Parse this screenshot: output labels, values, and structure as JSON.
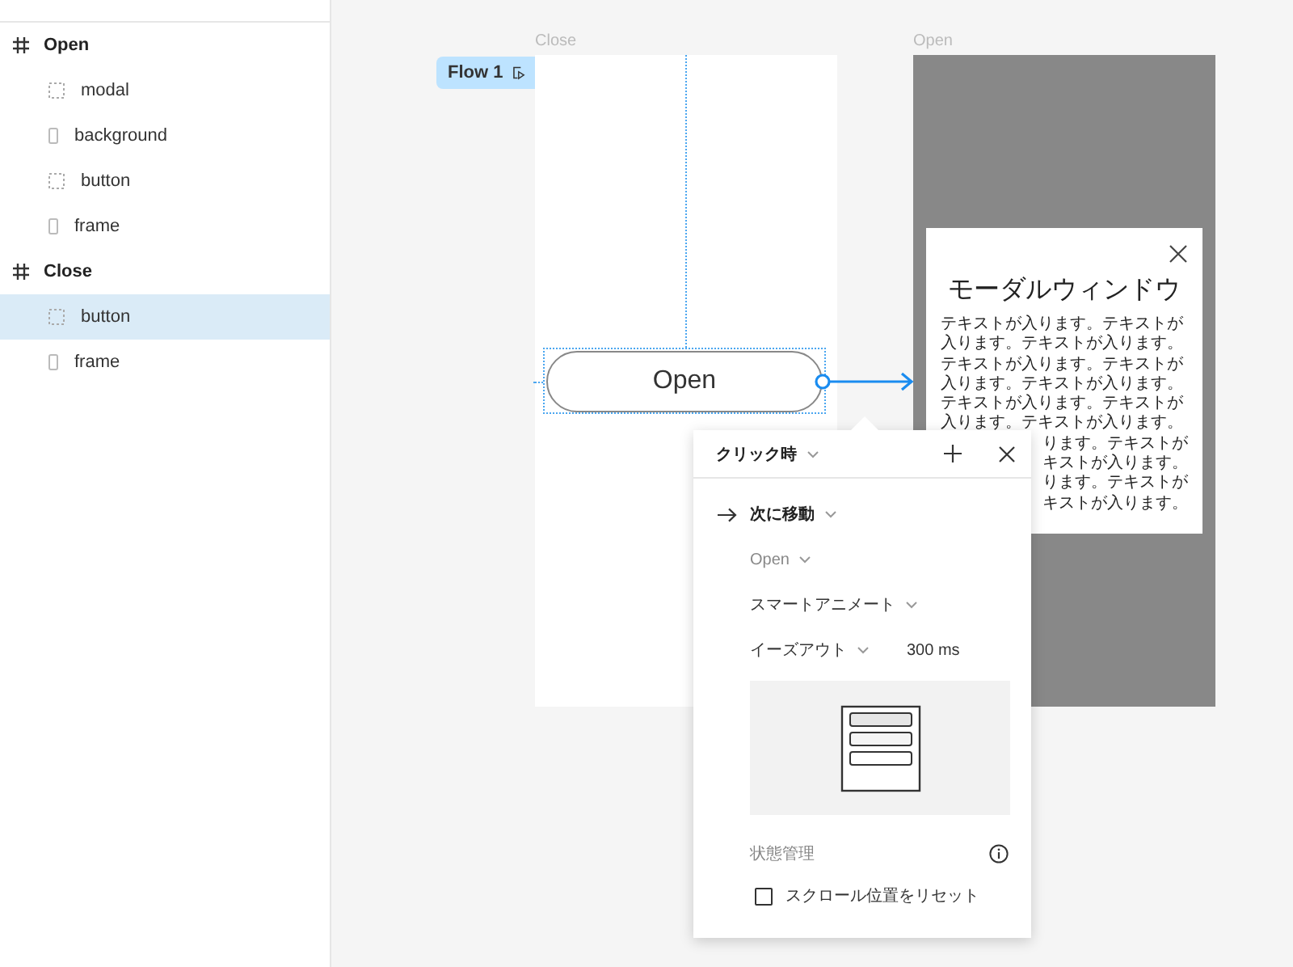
{
  "layers": [
    {
      "kind": "frame",
      "name": "Open",
      "selected": false,
      "children": [
        {
          "kind": "group",
          "name": "modal",
          "selected": false
        },
        {
          "kind": "rectangle",
          "name": "background",
          "selected": false
        },
        {
          "kind": "group",
          "name": "button",
          "selected": false
        },
        {
          "kind": "rectangle",
          "name": "frame",
          "selected": false
        }
      ]
    },
    {
      "kind": "frame",
      "name": "Close",
      "selected": false,
      "children": [
        {
          "kind": "group",
          "name": "button",
          "selected": true
        },
        {
          "kind": "rectangle",
          "name": "frame",
          "selected": false
        }
      ]
    }
  ],
  "canvas": {
    "flow_badge": "Flow 1",
    "close_frame": {
      "label": "Close",
      "button": "Open"
    },
    "open_frame": {
      "label": "Open",
      "modal": {
        "title": "モーダルウィンドウ",
        "lines": [
          "テキストが入ります。テキストが",
          "入ります。テキストが入ります。",
          "テキストが入ります。テキストが",
          "入ります。テキストが入ります。",
          "テキストが入ります。テキストが",
          "入ります。テキストが入ります。"
        ],
        "partly_hidden_lines": [
          "ります。テキストが",
          "キストが入ります。",
          "ります。テキストが",
          "キストが入ります。"
        ]
      }
    }
  },
  "prototype_popup": {
    "trigger": "クリック時",
    "action": "次に移動",
    "destination": "Open",
    "animation": "スマートアニメート",
    "easing": "イーズアウト",
    "duration": "300 ms",
    "state_label": "状態管理",
    "reset_scroll": {
      "label": "スクロール位置をリセット",
      "checked": false
    }
  }
}
